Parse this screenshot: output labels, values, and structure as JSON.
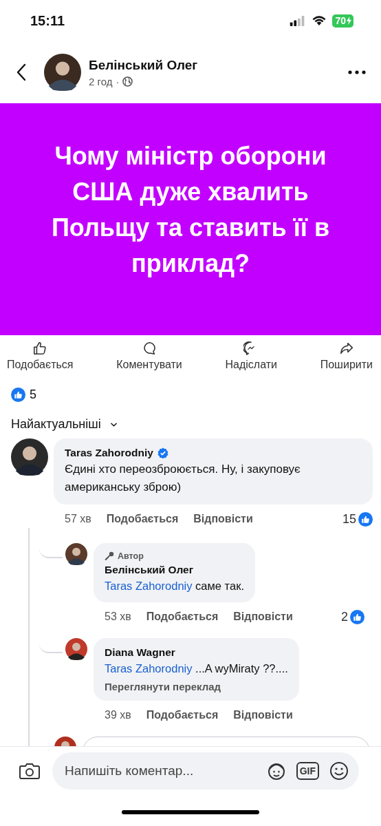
{
  "status_bar": {
    "time": "15:11",
    "battery": "70"
  },
  "header": {
    "author": "Белінський Олег",
    "time": "2 год",
    "separator": "·"
  },
  "post": {
    "title": "Чому міністр оборони США дуже хвалить Польщу та ставить її в приклад?"
  },
  "actions": [
    {
      "kind": "like",
      "label": "Подобається"
    },
    {
      "kind": "comment",
      "label": "Коментувати"
    },
    {
      "kind": "send",
      "label": "Надіслати"
    },
    {
      "kind": "share",
      "label": "Поширити"
    }
  ],
  "reactions": {
    "count": "5"
  },
  "sort": {
    "label": "Найактуальніші"
  },
  "comments": [
    {
      "author": "Taras Zahorodniy",
      "verified": true,
      "text": "Єдині хто переозброюється. Ну, і закуповує американську зброю)",
      "time": "57 хв",
      "like_label": "Подобається",
      "reply_label": "Відповісти",
      "reactions": "15",
      "children": [
        {
          "author": "Белінський Олег",
          "badge": "Автор",
          "verified": false,
          "mention": "Taras Zahorodniy",
          "text": "саме так.",
          "time": "53 хв",
          "like_label": "Подобається",
          "reply_label": "Відповісти",
          "reactions": "2"
        },
        {
          "author": "Diana Wagner",
          "verified": false,
          "mention": "Taras Zahorodniy",
          "text": "...A wyMiraty ??....",
          "translate": "Переглянути переклад",
          "time": "39 хв",
          "like_label": "Подобається",
          "reply_label": "Відповісти"
        }
      ]
    }
  ],
  "composer": {
    "placeholder": "Напишіть коментар...",
    "gif_label": "GIF"
  }
}
